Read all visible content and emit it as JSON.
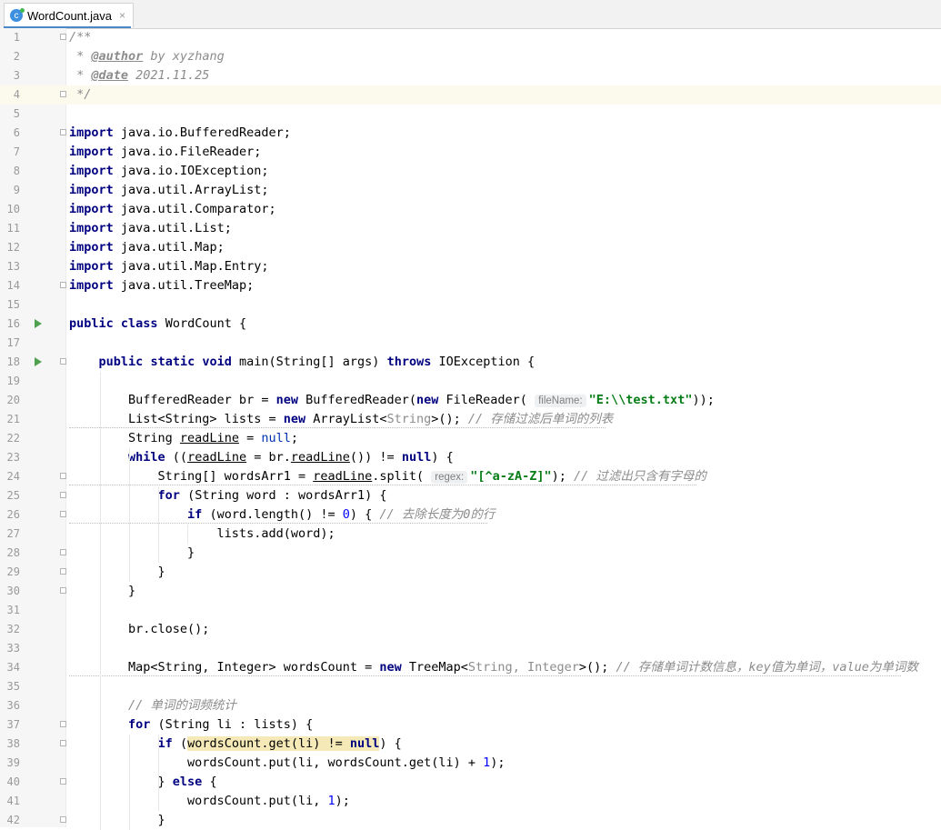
{
  "tab": {
    "filename": "WordCount.java",
    "icon": "java-class-icon",
    "close": "×"
  },
  "code_lines": [
    "/**",
    " * @author by xyzhang",
    " * @date 2021.11.25",
    " */",
    "",
    "import java.io.BufferedReader;",
    "import java.io.FileReader;",
    "import java.io.IOException;",
    "import java.util.ArrayList;",
    "import java.util.Comparator;",
    "import java.util.List;",
    "import java.util.Map;",
    "import java.util.Map.Entry;",
    "import java.util.TreeMap;",
    "",
    "public class WordCount {",
    "",
    "    public static void main(String[] args) throws IOException {",
    "",
    "        BufferedReader br = new BufferedReader(new FileReader( fileName: \"E:\\\\test.txt\"));",
    "        List<String> lists = new ArrayList<String>(); // 存储过滤后单词的列表",
    "        String readLine = null;",
    "        while ((readLine = br.readLine()) != null) {",
    "            String[] wordsArr1 = readLine.split( regex: \"[^a-zA-Z]\"); // 过滤出只含有字母的",
    "            for (String word : wordsArr1) {",
    "                if (word.length() != 0) { // 去除长度为0的行",
    "                    lists.add(word);",
    "                }",
    "            }",
    "        }",
    "",
    "        br.close();",
    "",
    "        Map<String, Integer> wordsCount = new TreeMap<String, Integer>(); // 存储单词计数信息，key值为单词，value为单词数",
    "",
    "        // 单词的词频统计",
    "        for (String li : lists) {",
    "            if (wordsCount.get(li) != null) {",
    "                wordsCount.put(li, wordsCount.get(li) + 1);",
    "            } else {",
    "                wordsCount.put(li, 1);",
    "            }"
  ],
  "line_numbers": [
    "1",
    "2",
    "3",
    "4",
    "5",
    "6",
    "7",
    "8",
    "9",
    "10",
    "11",
    "12",
    "13",
    "14",
    "15",
    "16",
    "17",
    "18",
    "19",
    "20",
    "21",
    "22",
    "23",
    "24",
    "25",
    "26",
    "27",
    "28",
    "29",
    "30",
    "31",
    "32",
    "33",
    "34",
    "35",
    "36",
    "37",
    "38",
    "39",
    "40",
    "41",
    "42"
  ],
  "current_line": 4,
  "run_marker_lines": [
    16,
    18
  ],
  "colors": {
    "keyword": "#000080",
    "string": "#067d17",
    "comment": "#8c8c8c",
    "number": "#0000ff",
    "current_line_bg": "#fcfaed",
    "highlight": "#f5eab7"
  }
}
